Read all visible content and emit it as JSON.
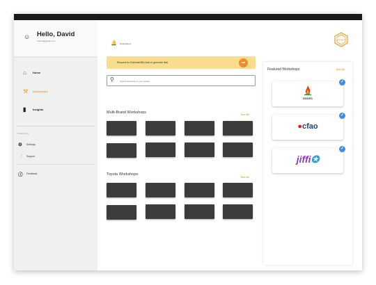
{
  "profile": {
    "greeting": "Hello, David",
    "email": "d.david@gmail.com"
  },
  "sidebar": {
    "items": [
      {
        "label": "Home",
        "icon": "home-icon"
      },
      {
        "label": "Workshops",
        "icon": "wrench-icon",
        "active": true
      },
      {
        "label": "Insights",
        "icon": "bar-chart-icon"
      }
    ],
    "preferences_label": "Preferences",
    "settings_label": "Settings",
    "support_label": "Support",
    "feedback_label": "Feedback"
  },
  "header": {
    "notifications_label": "Notifications",
    "logo_text": "AUTOWYTE"
  },
  "banner": {
    "text": "Request for Estimate/Bill (click to generate link)"
  },
  "search": {
    "placeholder": "Search workshop & your vehicle"
  },
  "sections": {
    "multi_brand": {
      "title": "Multi-Brand Workshops",
      "see_all": "See All"
    },
    "toyota": {
      "title": "Toyota Workshops",
      "see_all": "See All"
    }
  },
  "featured": {
    "title": "Featured Workshops",
    "see_all": "See All",
    "brands": [
      {
        "name": "ESDES"
      },
      {
        "name": "cfao"
      },
      {
        "name": "jiffi"
      }
    ]
  },
  "colors": {
    "accent": "#f0a030",
    "banner": "#f9dc8c",
    "share": "#f08c2a",
    "check": "#3b8ee6",
    "tile": "#3c3c3c"
  }
}
